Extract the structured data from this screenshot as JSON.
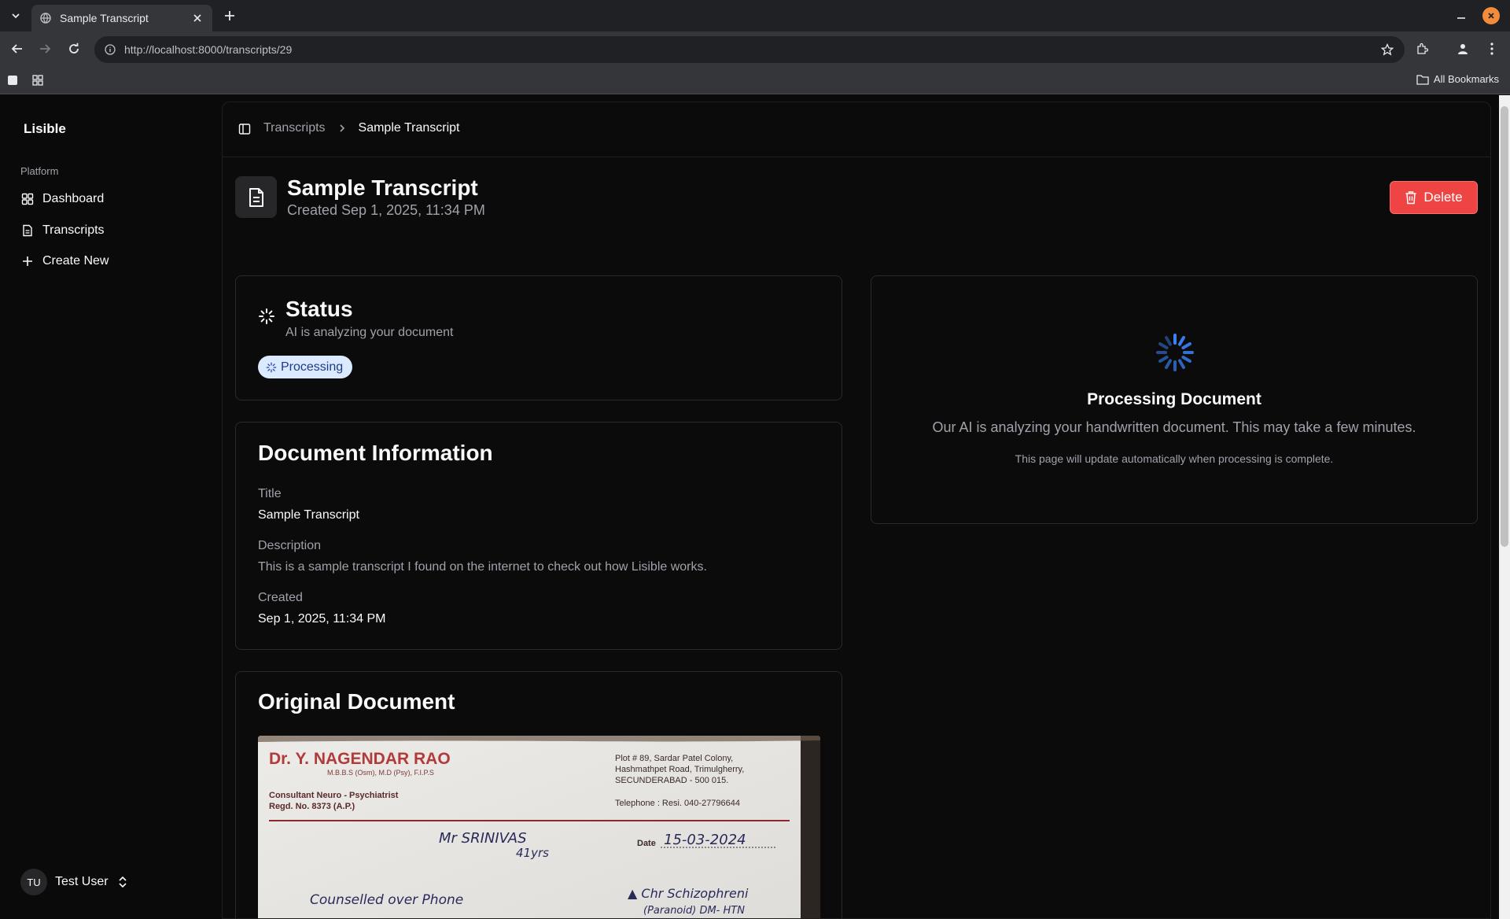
{
  "browser": {
    "tab_title": "Sample Transcript",
    "url": "http://localhost:8000/transcripts/29",
    "all_bookmarks": "All Bookmarks"
  },
  "sidebar": {
    "brand": "Lisible",
    "group_label": "Platform",
    "items": [
      {
        "label": "Dashboard",
        "icon": "dashboard-icon"
      },
      {
        "label": "Transcripts",
        "icon": "file-text-icon"
      },
      {
        "label": "Create New",
        "icon": "plus-icon"
      }
    ],
    "user": {
      "initials": "TU",
      "name": "Test User"
    }
  },
  "breadcrumb": {
    "parent": "Transcripts",
    "current": "Sample Transcript"
  },
  "header": {
    "title": "Sample Transcript",
    "created": "Created Sep 1, 2025, 11:34 PM",
    "delete_label": "Delete"
  },
  "status_card": {
    "title": "Status",
    "subtitle": "AI is analyzing your document",
    "badge": "Processing"
  },
  "document_info": {
    "heading": "Document Information",
    "title_label": "Title",
    "title_value": "Sample Transcript",
    "description_label": "Description",
    "description_value": "This is a sample transcript I found on the internet to check out how Lisible works.",
    "created_label": "Created",
    "created_value": "Sep 1, 2025, 11:34 PM"
  },
  "original_document": {
    "heading": "Original Document",
    "image": {
      "doctor": "Dr. Y. NAGENDAR RAO",
      "qualification": "M.B.B.S (Osm), M.D (Psy), F.I.P.S",
      "specialty": "Consultant Neuro - Psychiatrist",
      "regd": "Regd. No. 8373 (A.P.)",
      "address_1": "Plot # 89, Sardar Patel Colony,",
      "address_2": "Hashmathpet Road, Trimulgherry,",
      "address_3": "SECUNDERABAD - 500 015.",
      "telephone": "Telephone : Resi. 040-27796644",
      "date_label": "Date",
      "date_value": "15-03-2024",
      "patient": "Mr SRINIVAS",
      "age": "41yrs",
      "note_left": "Counselled over Phone",
      "note_right": "Chr Schizophreni",
      "note_right_2": "(Paranoid) DM- HTN"
    }
  },
  "processing": {
    "title": "Processing Document",
    "description": "Our AI is analyzing your handwritten document. This may take a few minutes.",
    "note": "This page will update automatically when processing is complete."
  },
  "colors": {
    "accent_blue": "#3b82f6",
    "delete_red": "#ef4444",
    "badge_bg": "#dbeafe"
  }
}
